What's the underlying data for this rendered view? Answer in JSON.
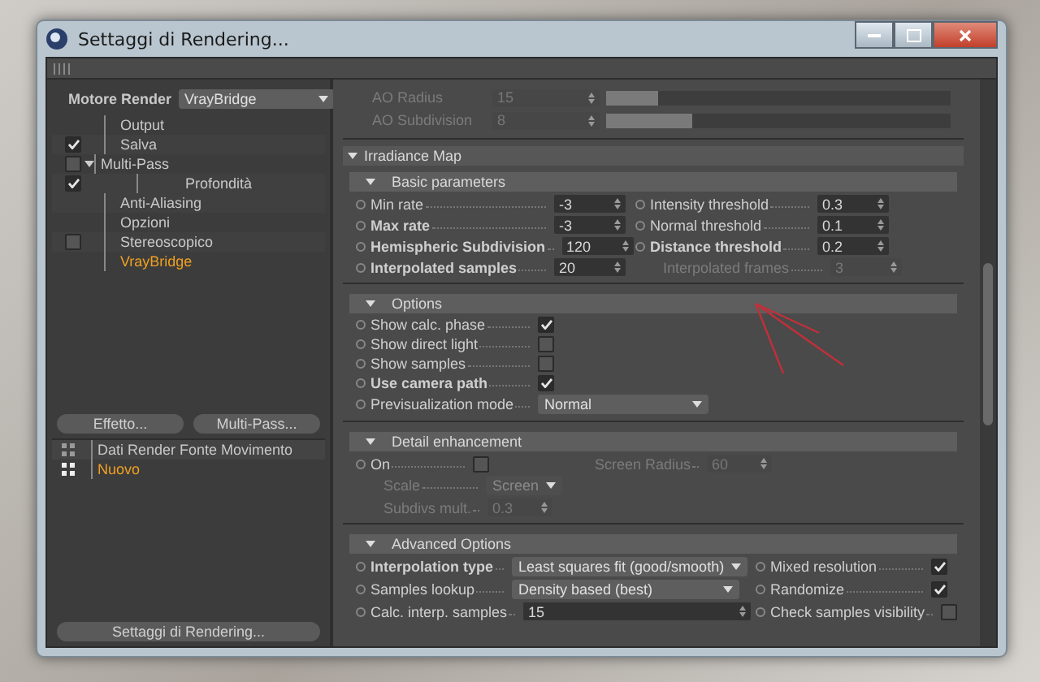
{
  "window": {
    "title": "Settaggi di Rendering..."
  },
  "sidebar": {
    "renderer": {
      "label": "Motore Render",
      "value": "VrayBridge"
    },
    "items": [
      {
        "label": "Output",
        "kind": "plain",
        "selected": false
      },
      {
        "label": "Salva",
        "kind": "check",
        "checked": true,
        "selected": false
      },
      {
        "label": "Multi-Pass",
        "kind": "check",
        "checked": false,
        "expanded": true,
        "selected": false,
        "children": [
          {
            "label": "Profondità",
            "kind": "check",
            "checked": true,
            "selected": false
          }
        ]
      },
      {
        "label": "Anti-Aliasing",
        "kind": "plain",
        "selected": false
      },
      {
        "label": "Opzioni",
        "kind": "plain",
        "selected": false
      },
      {
        "label": "Stereoscopico",
        "kind": "check",
        "checked": false,
        "selected": false
      },
      {
        "label": "VrayBridge",
        "kind": "plain",
        "selected": true
      }
    ],
    "buttons": [
      "Effetto...",
      "Multi-Pass..."
    ],
    "render_settings": [
      {
        "label": "Dati Render Fonte Movimento",
        "selected": false
      },
      {
        "label": "Nuovo",
        "selected": true
      }
    ],
    "footer_button": "Settaggi di Rendering..."
  },
  "ao_rows": [
    {
      "label": "AO Radius",
      "value": "15",
      "level": 0.15
    },
    {
      "label": "AO Subdivision",
      "value": "8",
      "level": 0.25
    }
  ],
  "section": {
    "title": "Irradiance Map",
    "expanded": true,
    "groups": [
      {
        "title": "Basic parameters",
        "expanded": true,
        "rows": [
          [
            {
              "kind": "number",
              "label": "Min rate",
              "value": "-3",
              "modified": false,
              "disabled": false
            },
            {
              "kind": "number",
              "label": "Intensity threshold",
              "value": "0.3",
              "modified": false,
              "disabled": false
            }
          ],
          [
            {
              "kind": "number",
              "label": "Max rate",
              "value": "-3",
              "modified": true,
              "disabled": false
            },
            {
              "kind": "number",
              "label": "Normal threshold",
              "value": "0.1",
              "modified": false,
              "disabled": false
            }
          ],
          [
            {
              "kind": "number",
              "label": "Hemispheric Subdivision",
              "value": "120",
              "modified": true,
              "disabled": false
            },
            {
              "kind": "number",
              "label": "Distance threshold",
              "value": "0.2",
              "modified": true,
              "disabled": false
            }
          ],
          [
            {
              "kind": "number",
              "label": "Interpolated samples",
              "value": "20",
              "modified": true,
              "disabled": false
            },
            {
              "kind": "number",
              "label": "Interpolated frames",
              "value": "3",
              "modified": false,
              "disabled": true
            }
          ]
        ]
      },
      {
        "title": "Options",
        "expanded": true,
        "rows": [
          [
            {
              "kind": "checkbox",
              "label": "Show calc. phase",
              "checked": true,
              "modified": false,
              "disabled": false
            }
          ],
          [
            {
              "kind": "checkbox",
              "label": "Show direct light",
              "checked": false,
              "modified": false,
              "disabled": false
            }
          ],
          [
            {
              "kind": "checkbox",
              "label": "Show samples",
              "checked": false,
              "modified": false,
              "disabled": false
            }
          ],
          [
            {
              "kind": "checkbox",
              "label": "Use camera path",
              "checked": true,
              "modified": true,
              "disabled": false
            }
          ],
          [
            {
              "kind": "dropdown",
              "label": "Previsualization mode",
              "value": "Normal",
              "modified": false,
              "disabled": false
            }
          ]
        ]
      },
      {
        "title": "Detail enhancement",
        "expanded": true,
        "rows": [
          [
            {
              "kind": "checkbox",
              "label": "On",
              "checked": false,
              "modified": false,
              "disabled": false
            },
            {
              "kind": "number",
              "label": "Screen Radius",
              "value": "60",
              "modified": false,
              "disabled": true
            }
          ],
          [
            {
              "kind": "dropdown",
              "label": "Scale",
              "value": "Screen",
              "modified": false,
              "disabled": true
            }
          ],
          [
            {
              "kind": "number",
              "label": "Subdivs mult.",
              "value": "0.3",
              "modified": false,
              "disabled": true
            }
          ]
        ]
      },
      {
        "title": "Advanced Options",
        "expanded": true,
        "rows": [
          [
            {
              "kind": "dropdown",
              "label": "Interpolation type",
              "value": "Least squares fit (good/smooth)",
              "modified": true,
              "disabled": false
            },
            {
              "kind": "checkbox",
              "label": "Mixed resolution",
              "checked": true,
              "modified": false,
              "disabled": false
            }
          ],
          [
            {
              "kind": "dropdown",
              "label": "Samples lookup",
              "value": "Density based (best)",
              "modified": false,
              "disabled": false
            },
            {
              "kind": "checkbox",
              "label": "Randomize",
              "checked": true,
              "modified": false,
              "disabled": false
            }
          ],
          [
            {
              "kind": "number",
              "label": "Calc. interp. samples",
              "value": "15",
              "modified": false,
              "disabled": false
            },
            {
              "kind": "checkbox",
              "label": "Check samples visibility",
              "checked": false,
              "modified": false,
              "disabled": false
            }
          ]
        ]
      }
    ]
  }
}
